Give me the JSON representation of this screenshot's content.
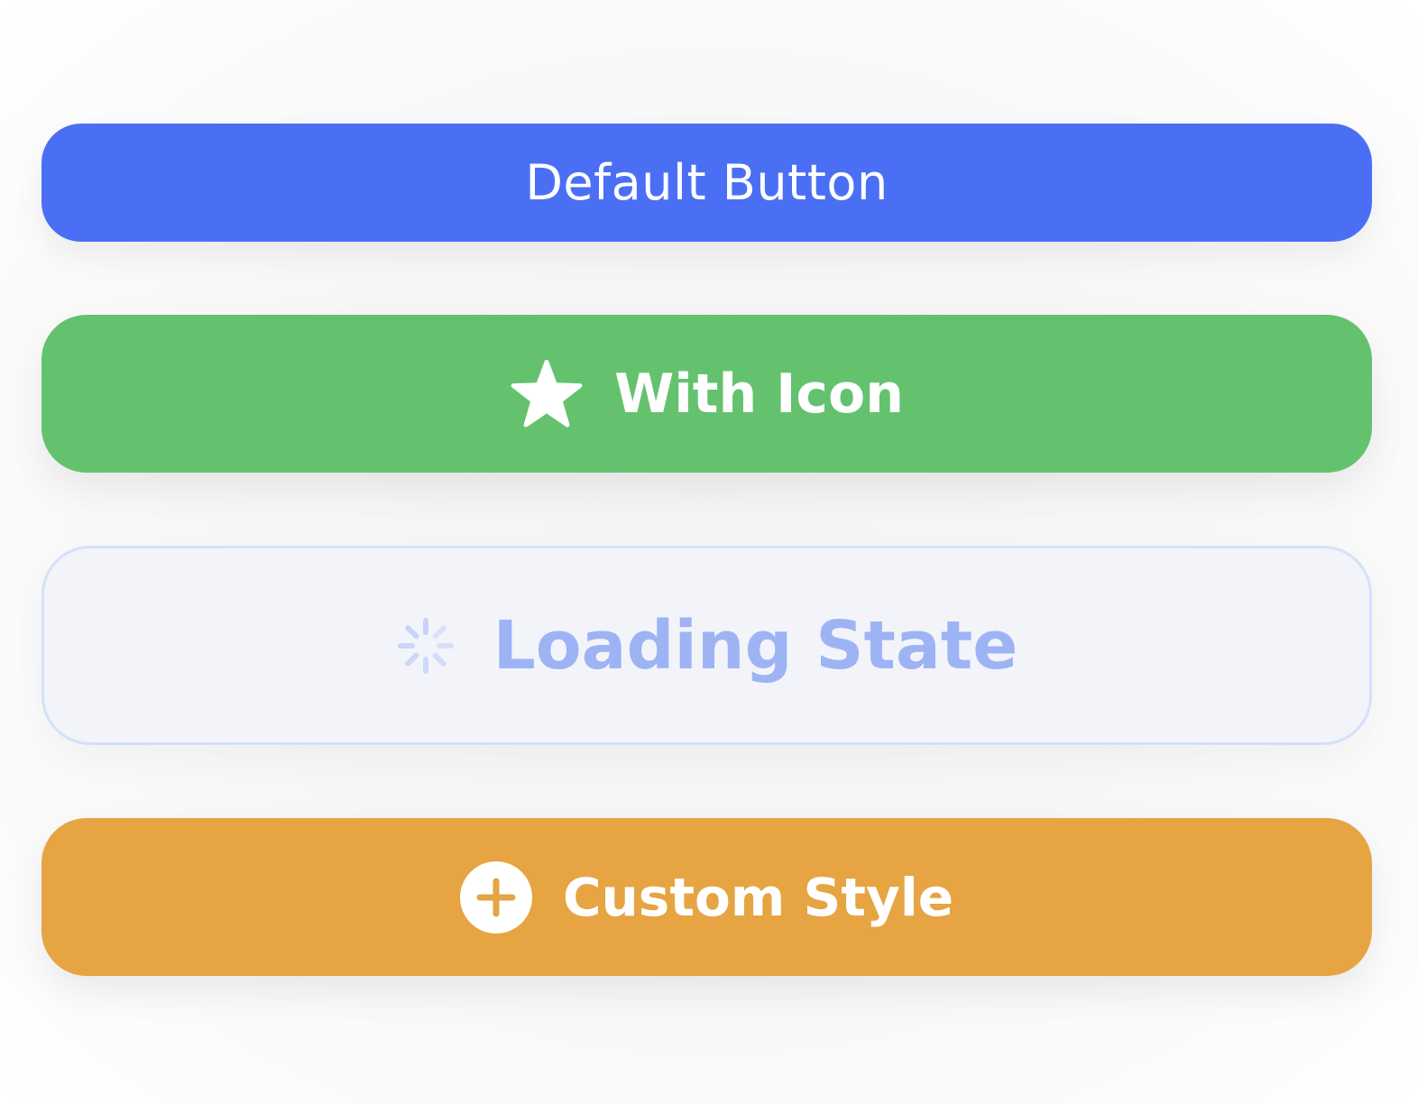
{
  "buttons": {
    "default": {
      "label": "Default Button"
    },
    "with_icon": {
      "label": "With Icon",
      "icon": "star-icon"
    },
    "loading": {
      "label": "Loading State",
      "icon": "spinner-icon"
    },
    "custom": {
      "label": "Custom Style",
      "icon": "plus-circle-icon"
    }
  },
  "colors": {
    "default_bg": "#4b6ff4",
    "with_icon_bg": "#64c26e",
    "loading_bg": "#f3f4fa",
    "loading_border": "#d6e0fb",
    "loading_text": "#9db3f4",
    "custom_bg": "#e6a443",
    "text_on_fill": "#ffffff"
  }
}
